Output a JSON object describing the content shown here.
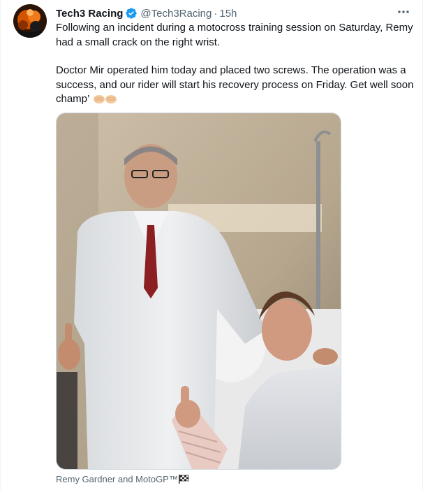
{
  "tweet": {
    "author_name": "Tech3 Racing",
    "handle": "@Tech3Racing",
    "separator": "·",
    "time": "15h",
    "paragraphs": [
      "Following an incident during a motocross training session on Saturday, Remy had a small crack on the right wrist.",
      "Doctor Mir operated him today and placed two screws. The operation was a success, and our rider will start his recovery process on Friday. Get well soon champ’"
    ],
    "media_caption": "Remy Gardner and MotoGP™"
  },
  "icons": {
    "verified": "verified-badge-icon",
    "more": "more-options-icon",
    "fists": "fist-bump-emoji-icon",
    "flag": "checkered-flag-icon"
  },
  "colors": {
    "text": "#0f1419",
    "secondary": "#536471",
    "verified_blue": "#1d9bf0",
    "border": "#cfd9de"
  }
}
